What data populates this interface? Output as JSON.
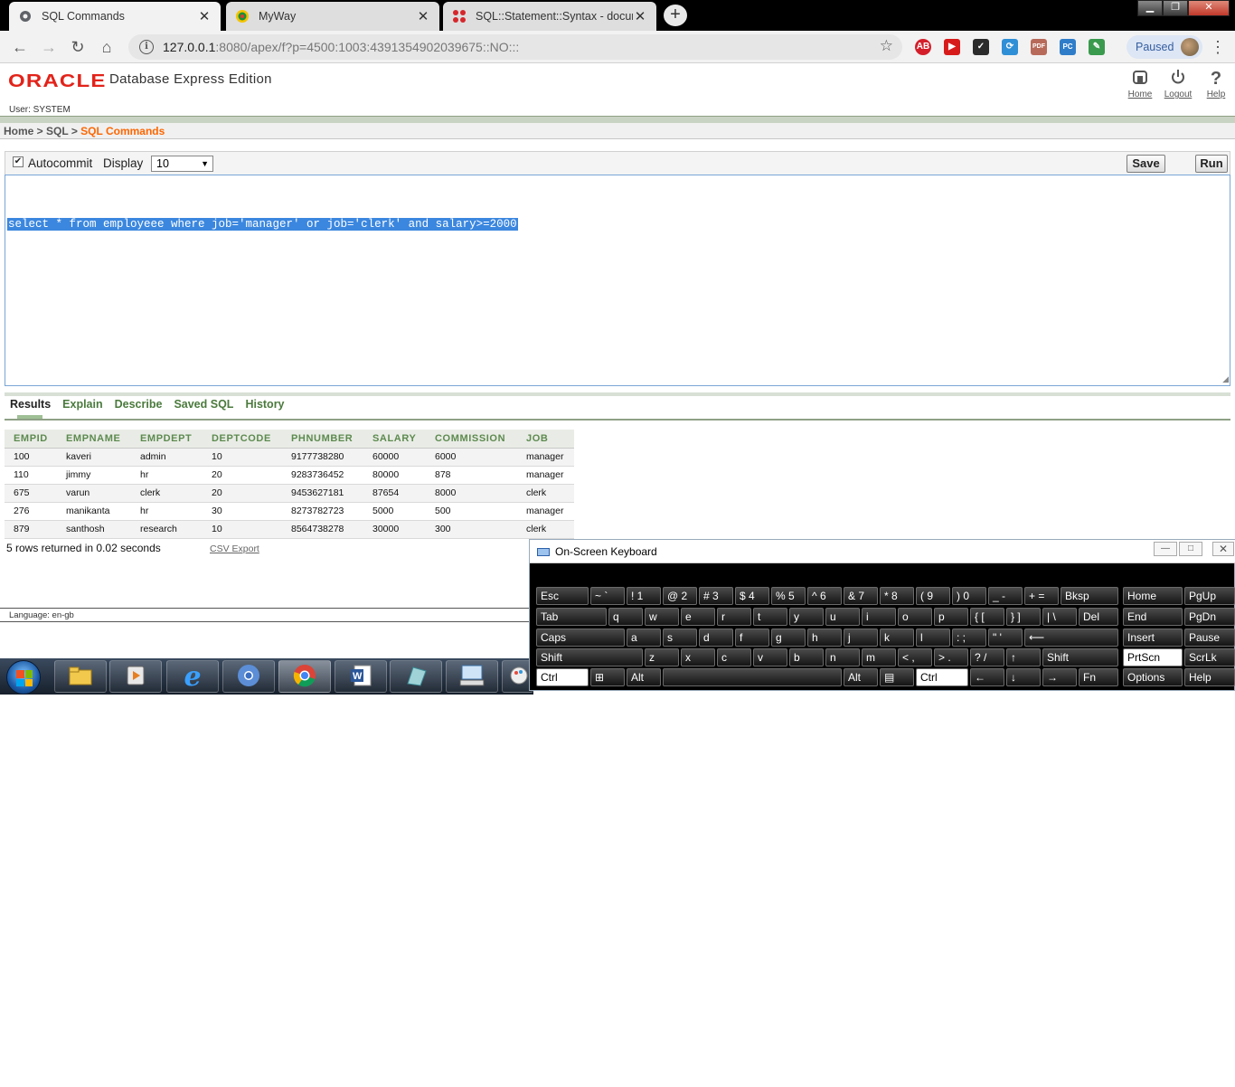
{
  "browser": {
    "tabs": [
      {
        "title": "SQL Commands",
        "active": true
      },
      {
        "title": "MyWay",
        "active": false
      },
      {
        "title": "SQL::Statement::Syntax - docume",
        "active": false
      }
    ],
    "new_tab": "+",
    "url_host": "127.0.0.1",
    "url_rest": ":8080/apex/f?p=4500:1003:4391354902039675::NO:::",
    "paused_label": "Paused",
    "extensions": [
      "AB",
      "▶",
      "✓",
      "⟳",
      "PDF",
      "PC",
      "✎"
    ]
  },
  "oracle": {
    "logo": "ORACLE",
    "product": "Database Express Edition",
    "user": "User: SYSTEM",
    "links": [
      {
        "label": "Home",
        "icon": "home-icon"
      },
      {
        "label": "Logout",
        "icon": "power-icon"
      },
      {
        "label": "Help",
        "icon": "help-icon"
      }
    ]
  },
  "breadcrumb": {
    "home": "Home",
    "sep": " > ",
    "sql": "SQL",
    "current": "SQL Commands"
  },
  "cmdbar": {
    "autocommit_label": "Autocommit",
    "autocommit_checked": true,
    "display_label": "Display",
    "display_value": "10",
    "save_label": "Save",
    "run_label": "Run"
  },
  "editor": {
    "sql": "select * from employeee where job='manager' or job='clerk' and salary>=2000"
  },
  "result_tabs": [
    "Results",
    "Explain",
    "Describe",
    "Saved SQL",
    "History"
  ],
  "results": {
    "columns": [
      "EMPID",
      "EMPNAME",
      "EMPDEPT",
      "DEPTCODE",
      "PHNUMBER",
      "SALARY",
      "COMMISSION",
      "JOB"
    ],
    "rows": [
      [
        "100",
        "kaveri",
        "admin",
        "10",
        "9177738280",
        "60000",
        "6000",
        "manager"
      ],
      [
        "110",
        "jimmy",
        "hr",
        "20",
        "9283736452",
        "80000",
        "878",
        "manager"
      ],
      [
        "675",
        "varun",
        "clerk",
        "20",
        "9453627181",
        "87654",
        "8000",
        "clerk"
      ],
      [
        "276",
        "manikanta",
        "hr",
        "30",
        "8273782723",
        "5000",
        "500",
        "manager"
      ],
      [
        "879",
        "santhosh",
        "research",
        "10",
        "8564738278",
        "30000",
        "300",
        "clerk"
      ]
    ],
    "summary": "5 rows returned in 0.02 seconds",
    "csv_label": "CSV Export"
  },
  "footer": {
    "language": "Language: en-gb"
  },
  "osk": {
    "title": "On-Screen Keyboard",
    "rows": [
      [
        "Esc",
        "~ `",
        "! 1",
        "@ 2",
        "# 3",
        "$ 4",
        "% 5",
        "^ 6",
        "& 7",
        "* 8",
        "( 9",
        ") 0",
        "_ -",
        "+ =",
        "Bksp",
        "Home",
        "PgUp"
      ],
      [
        "Tab",
        "q",
        "w",
        "e",
        "r",
        "t",
        "y",
        "u",
        "i",
        "o",
        "p",
        "{ [",
        "} ]",
        "| \\",
        "Del",
        "End",
        "PgDn"
      ],
      [
        "Caps",
        "a",
        "s",
        "d",
        "f",
        "g",
        "h",
        "j",
        "k",
        "l",
        ": ;",
        "\" '",
        "⟵",
        "Insert",
        "Pause"
      ],
      [
        "Shift",
        "z",
        "x",
        "c",
        "v",
        "b",
        "n",
        "m",
        "< ,",
        "> .",
        "? /",
        "↑",
        "Shift",
        "PrtScn",
        "ScrLk"
      ],
      [
        "Ctrl",
        "⊞",
        "Alt",
        "",
        "Alt",
        "▤",
        "Ctrl",
        "←",
        "↓",
        "→",
        "Fn",
        "Options",
        "Help"
      ]
    ]
  }
}
